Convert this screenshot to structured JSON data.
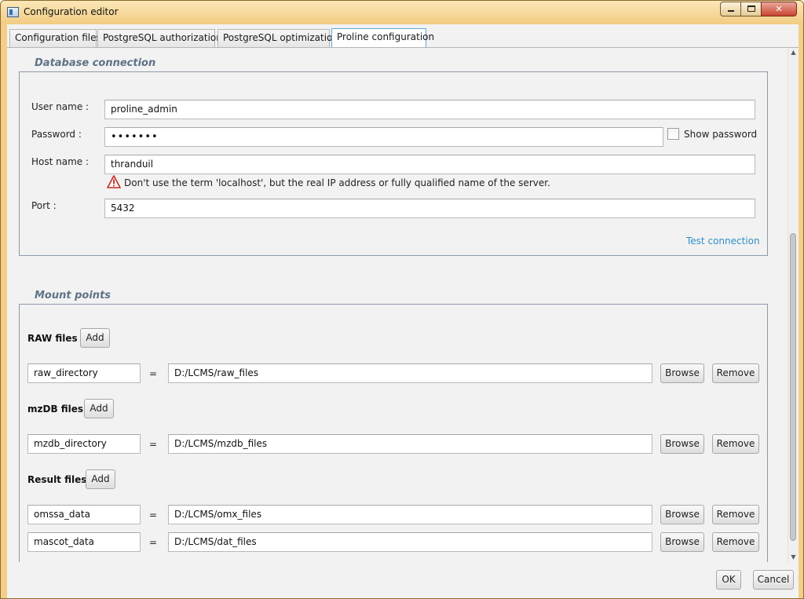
{
  "window": {
    "title": "Configuration editor"
  },
  "tabs": [
    {
      "label": "Configuration files"
    },
    {
      "label": "PostgreSQL authorizations"
    },
    {
      "label": "PostgreSQL optimization"
    },
    {
      "label": "Proline configuration",
      "active": true
    }
  ],
  "database": {
    "legend": "Database connection",
    "user_label": "User name :",
    "user_value": "proline_admin",
    "password_label": "Password :",
    "password_value": "•••••••",
    "show_password_label": "Show password",
    "host_label": "Host name :",
    "host_value": "thranduil",
    "host_warning": "Don't use the term 'localhost', but the real IP address or fully qualified name of the server.",
    "port_label": "Port :",
    "port_value": "5432",
    "test_connection": "Test connection"
  },
  "mounts": {
    "legend": "Mount points",
    "equals": "=",
    "browse_label": "Browse",
    "remove_label": "Remove",
    "add_label": "Add",
    "groups": {
      "raw": {
        "label": "RAW files :",
        "entries": [
          {
            "name": "raw_directory",
            "path": "D:/LCMS/raw_files"
          }
        ]
      },
      "mzdb": {
        "label": "mzDB files :",
        "entries": [
          {
            "name": "mzdb_directory",
            "path": "D:/LCMS/mzdb_files"
          }
        ]
      },
      "result": {
        "label": "Result files :",
        "entries": [
          {
            "name": "omssa_data",
            "path": "D:/LCMS/omx_files"
          },
          {
            "name": "mascot_data",
            "path": "D:/LCMS/dat_files"
          }
        ]
      }
    }
  },
  "footer": {
    "ok_label": "OK",
    "cancel_label": "Cancel"
  },
  "colors": {
    "accent": "#64a6da",
    "link": "#2f8fc9",
    "legend": "#5e7287",
    "warning": "#c62a1e"
  }
}
